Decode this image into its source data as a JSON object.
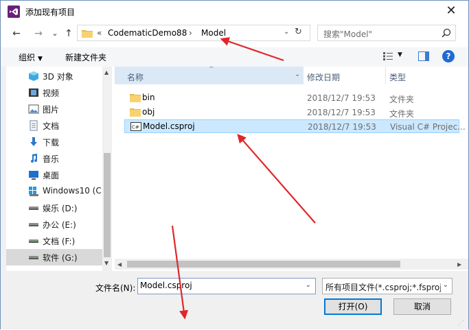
{
  "window": {
    "title": "添加现有项目",
    "close_glyph": "✕"
  },
  "nav": {
    "back_glyph": "←",
    "forward_glyph": "→",
    "recent_glyph": "⌄",
    "up_glyph": "↑",
    "breadcrumb": [
      "«",
      "CodematicDemo88",
      "›",
      "Model"
    ],
    "refresh_glyph": "↻",
    "dropdown_glyph": "⌄"
  },
  "search": {
    "placeholder": "搜索\"Model\""
  },
  "toolbar": {
    "organize_label": "组织",
    "new_folder_label": "新建文件夹",
    "caret": "▼",
    "help_label": "?"
  },
  "sidebar": {
    "items": [
      {
        "label": "3D 对象",
        "icon": "cube-icon"
      },
      {
        "label": "视频",
        "icon": "video-icon"
      },
      {
        "label": "图片",
        "icon": "pictures-icon"
      },
      {
        "label": "文档",
        "icon": "documents-icon"
      },
      {
        "label": "下载",
        "icon": "download-icon"
      },
      {
        "label": "音乐",
        "icon": "music-icon"
      },
      {
        "label": "桌面",
        "icon": "desktop-icon"
      },
      {
        "label": "Windows10 (C:",
        "icon": "windows-drive-icon"
      },
      {
        "label": "娱乐 (D:)",
        "icon": "drive-icon"
      },
      {
        "label": "办公 (E:)",
        "icon": "drive-icon"
      },
      {
        "label": "文档 (F:)",
        "icon": "drive-icon"
      },
      {
        "label": "软件 (G:)",
        "icon": "drive-icon"
      }
    ],
    "selected_index": 11
  },
  "file_list": {
    "columns": [
      "名称",
      "修改日期",
      "类型"
    ],
    "sort_glyph": "^",
    "rows": [
      {
        "name": "bin",
        "date": "2018/12/7 19:53",
        "type": "文件夹",
        "icon": "folder-icon"
      },
      {
        "name": "obj",
        "date": "2018/12/7 19:53",
        "type": "文件夹",
        "icon": "folder-icon"
      },
      {
        "name": "Model.csproj",
        "date": "2018/12/7 19:53",
        "type": "Visual C# Projec...",
        "icon": "csproj-icon"
      }
    ],
    "selected_index": 2
  },
  "bottom": {
    "filename_label": "文件名(N):",
    "filename_value": "Model.csproj",
    "filter_value": "所有项目文件(*.csproj;*.fsproj",
    "open_label": "打开(O)",
    "cancel_label": "取消"
  },
  "colors": {
    "accent": "#0078d7",
    "annotation_arrow": "#e0262a",
    "vs_purple": "#68217a"
  }
}
